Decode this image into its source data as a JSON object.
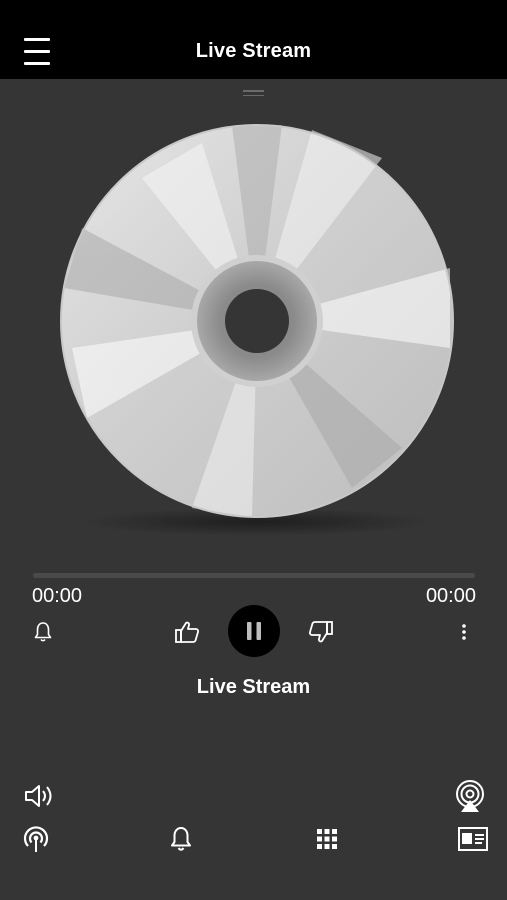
{
  "header": {
    "title": "Live Stream",
    "menu_icon": "hamburger-menu-icon"
  },
  "player": {
    "artwork": "cd-disc-artwork",
    "progress": 0,
    "elapsed": "00:00",
    "duration": "00:00",
    "track_title": "Live Stream",
    "controls": {
      "alarm_icon": "bell-icon",
      "like_icon": "thumbs-up-icon",
      "play_state_icon": "pause-icon",
      "dislike_icon": "thumbs-down-icon",
      "more_icon": "more-vertical-icon"
    }
  },
  "bottom_bar": {
    "volume_icon": "volume-icon",
    "airplay_icon": "airplay-icon",
    "podcast_icon": "podcast-icon",
    "notifications_icon": "bell-icon",
    "grid_icon": "grid-icon",
    "contact_icon": "contact-card-icon"
  },
  "colors": {
    "header_bg": "#000000",
    "body_bg": "#353535",
    "text": "#ffffff",
    "progress_track": "#4a4a4a"
  }
}
